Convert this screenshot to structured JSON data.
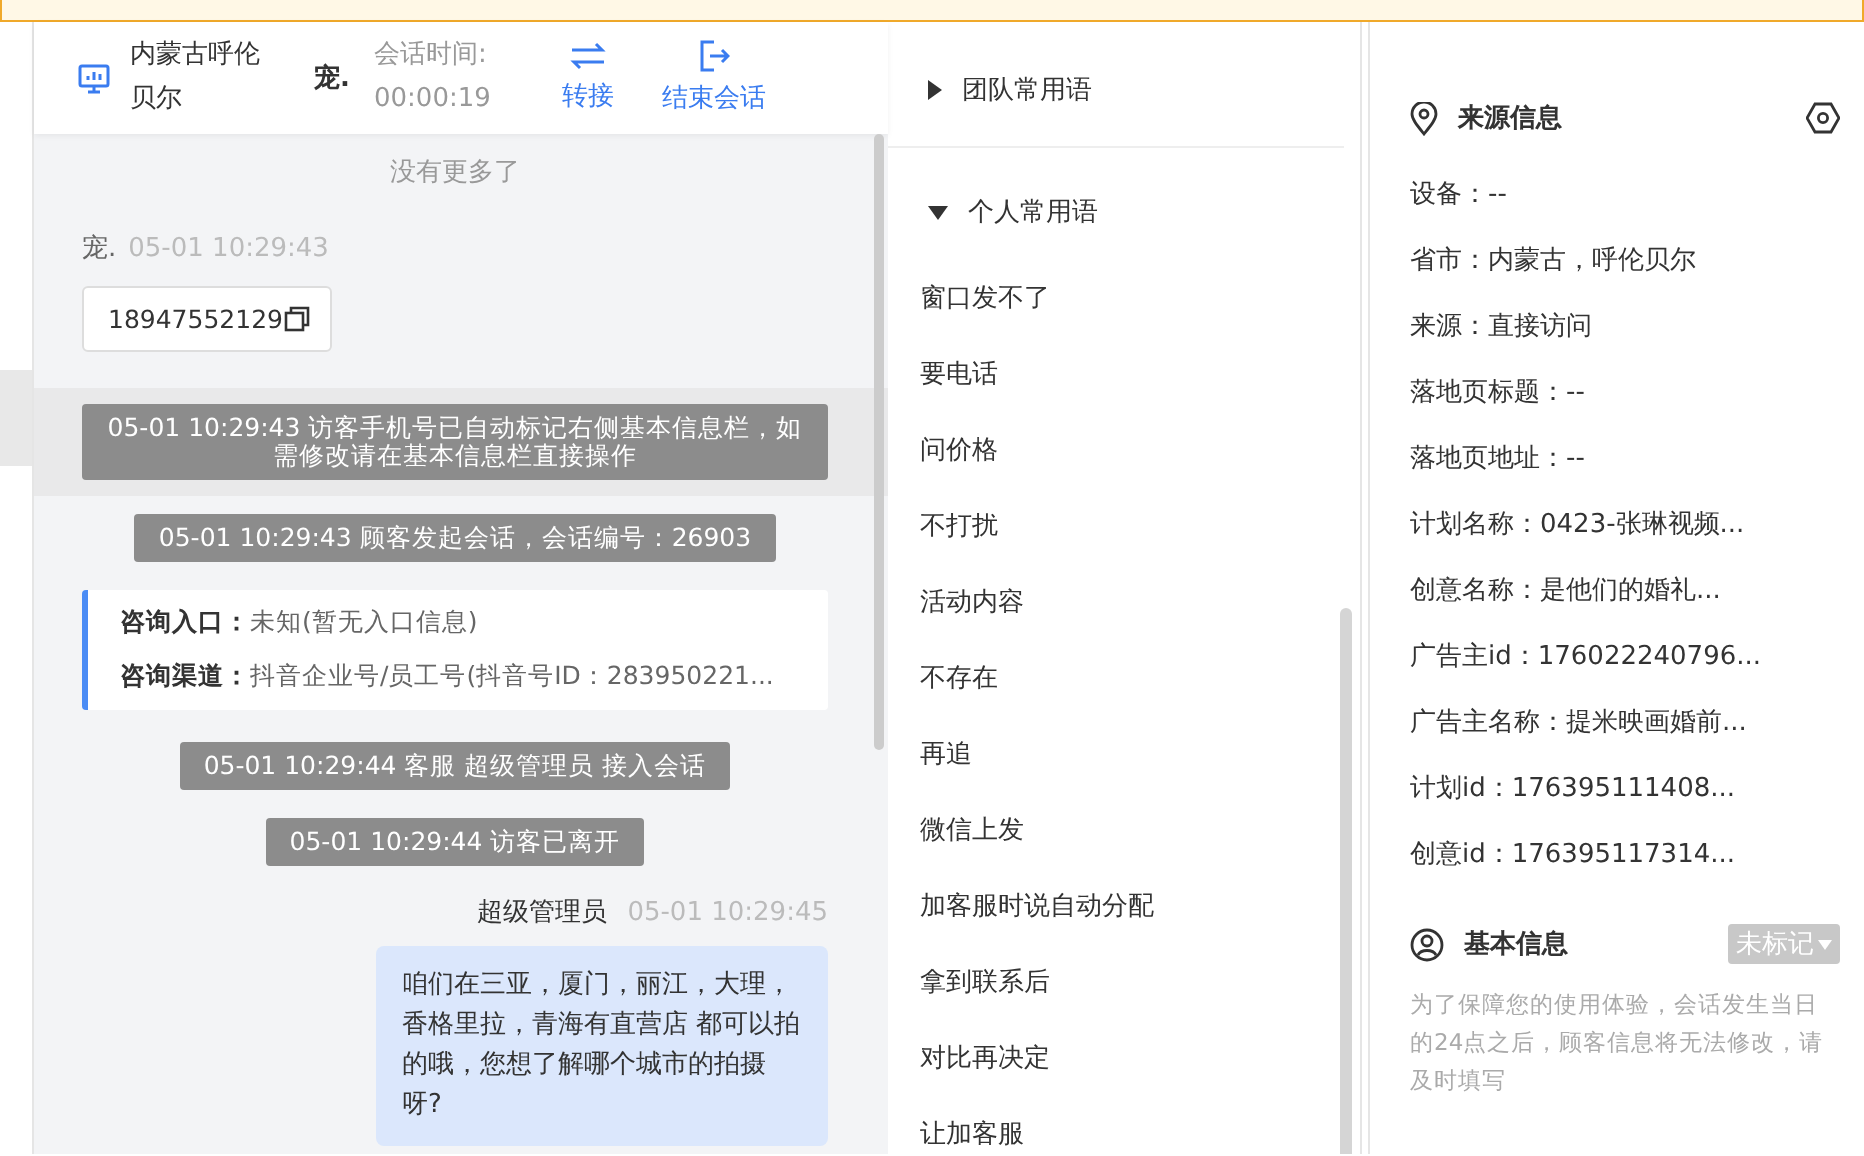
{
  "chat_header": {
    "location": "内蒙古呼伦贝尔",
    "visitor": "宠.",
    "time_label": "会话时间:",
    "time": "00:00:19",
    "actions": [
      {
        "label": "转接",
        "kind": "transfer"
      },
      {
        "label": "结束会话",
        "kind": "end"
      }
    ]
  },
  "messages": [
    {
      "kind": "notice",
      "text": "没有更多了"
    },
    {
      "kind": "visitor",
      "name": "宠.",
      "time": "05-01 10:29:43",
      "text": "18947552129"
    },
    {
      "kind": "system",
      "highlighted": true,
      "text": "05-01 10:29:43 访客手机号已自动标记右侧基本信息栏，如需修改请在基本信息栏直接操作"
    },
    {
      "kind": "system",
      "highlighted": false,
      "text": "05-01 10:29:43 顾客发起会话，会话编号：26903"
    },
    {
      "kind": "entry",
      "fields": [
        {
          "label": "咨询入口：",
          "value": "未知(暂无入口信息)"
        },
        {
          "label": "咨询渠道：",
          "value": "抖音企业号/员工号(抖音号ID：283950221..."
        }
      ]
    },
    {
      "kind": "system",
      "highlighted": false,
      "text": "05-01 10:29:44 客服 超级管理员 接入会话"
    },
    {
      "kind": "system",
      "highlighted": false,
      "text": "05-01 10:29:44 访客已离开"
    },
    {
      "kind": "agent",
      "name": "超级管理员",
      "time": "05-01 10:29:45",
      "text": "咱们在三亚，厦门，丽江，大理，香格里拉，青海有直营店 都可以拍的哦，您想了解哪个城市的拍摄呀?"
    }
  ],
  "phrase_groups": [
    {
      "label": "团队常用语",
      "expanded": false
    },
    {
      "label": "个人常用语",
      "expanded": true,
      "items": [
        "窗口发不了",
        "要电话",
        "问价格",
        "不打扰",
        "活动内容",
        "不存在",
        "再追",
        "微信上发",
        "加客服时说自动分配",
        "拿到联系后",
        "对比再决定",
        "让加客服"
      ]
    }
  ],
  "source_info": {
    "title": "来源信息",
    "fields": [
      "设备：--",
      "省市：内蒙古，呼伦贝尔",
      "来源：直接访问",
      "落地页标题：--",
      "落地页地址：--",
      "计划名称：0423-张琳视频...",
      "创意名称：是他们的婚礼...",
      "广告主id：176022240796...",
      "广告主名称：提米映画婚前...",
      "计划id：176395111408...",
      "创意id：176395117314..."
    ]
  },
  "basic_info": {
    "title": "基本信息",
    "tag": "未标记",
    "note": "为了保障您的使用体验，会话发生当日的24点之后，顾客信息将无法修改，请及时填写"
  }
}
